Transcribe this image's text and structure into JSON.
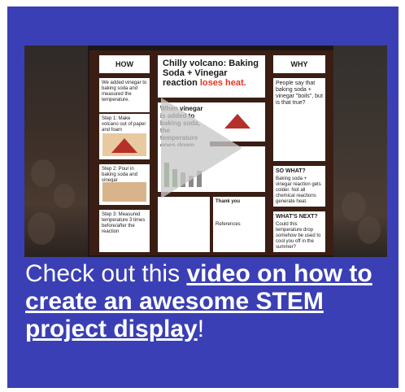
{
  "video": {
    "board": {
      "how_heading": "HOW",
      "how_text": "We added vinegar to baking soda and measured the temperature.",
      "step1": "Step 1: Make volcano out of paper and foam",
      "step2": "Step 2: Pour in baking soda and vinegar",
      "step3": "Step 3: Measured temperature 3 times before/after the reaction",
      "title_main": "Chilly volcano: Baking Soda + Vinegar reaction",
      "title_highlight": "loses heat.",
      "center_q": "When vinegar is added to baking soda, the temperature goes down.",
      "why_heading": "WHY",
      "why_text": "People say that baking soda + vinegar \"boils\", but is that true?",
      "sowhat_heading": "SO WHAT?",
      "sowhat_text": "Baking soda + vinegar reaction gets colder. Not all chemical reactions generate heat.",
      "next_heading": "WHAT'S NEXT?",
      "next_text": "Could this temperature drop somehow be used to cool you off in the summer?",
      "thanks": "Thank you",
      "refs": "References"
    }
  },
  "caption": {
    "lead": "Check out this ",
    "link": "video on how to create an awesome STEM project display",
    "tail": "!"
  }
}
